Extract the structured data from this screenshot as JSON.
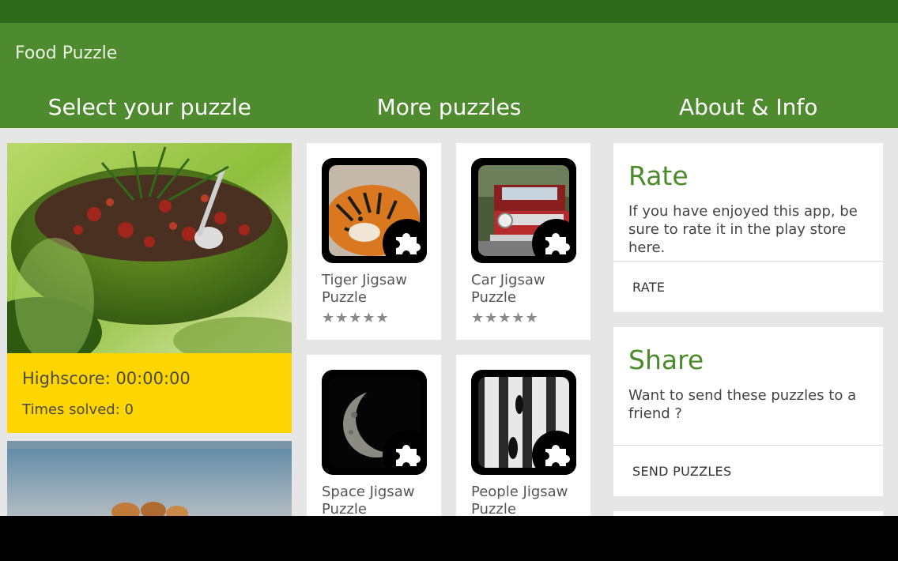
{
  "app": {
    "title": "Food Puzzle"
  },
  "tabs": [
    {
      "label": "Select your puzzle"
    },
    {
      "label": "More puzzles"
    },
    {
      "label": "About & Info"
    }
  ],
  "puzzle_cards": [
    {
      "highscore_label": "Highscore: 00:00:00",
      "times_solved_label": "Times solved: 0"
    }
  ],
  "more_puzzles": [
    {
      "name": "Tiger Jigsaw Puzzle",
      "stars": "★★★★★",
      "icon": "tiger-photo-icon"
    },
    {
      "name": "Car Jigsaw Puzzle",
      "stars": "★★★★★",
      "icon": "car-photo-icon"
    },
    {
      "name": "Space Jigsaw Puzzle",
      "stars": "★★★★★",
      "icon": "moon-photo-icon"
    },
    {
      "name": "People Jigsaw Puzzle",
      "stars": "★★★★★",
      "icon": "people-photo-icon"
    }
  ],
  "info_cards": [
    {
      "title": "Rate",
      "text": "If you have enjoyed this app, be sure to rate it in the play store here.",
      "button": "RATE"
    },
    {
      "title": "Share",
      "text": "Want to send these puzzles to a friend ?",
      "button": "SEND PUZZLES"
    }
  ],
  "colors": {
    "status_bar": "#2f6a1d",
    "action_bar": "#4e8b2e",
    "accent_text": "#4a8a2a",
    "score_card": "#ffd500",
    "background": "#e6e6e6"
  }
}
